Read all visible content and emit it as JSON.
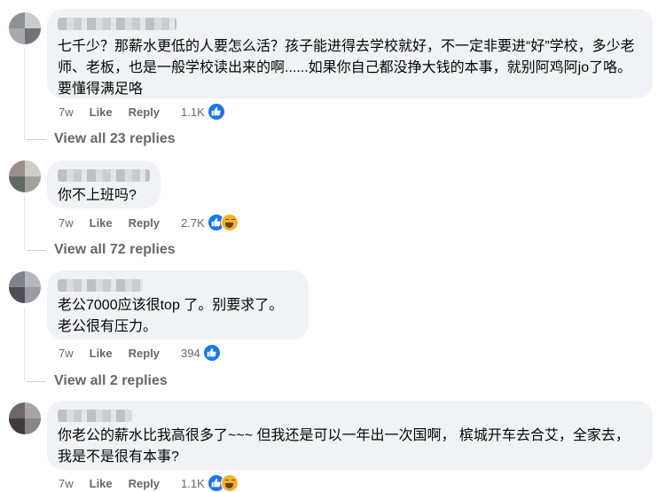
{
  "comments": [
    {
      "text": "七千少？那薪水更低的人要怎么活？孩子能进得去学校就好，不一定非要进“好”学校，多少老师、老板，也是一般学校读出来的啊......如果你自己都没挣大钱的本事，就别阿鸡阿jo了咯。要懂得满足咯",
      "time": "7w",
      "like_label": "Like",
      "reply_label": "Reply",
      "reaction_count": "1.1K",
      "reactions": [
        "like-icon"
      ],
      "replies_label": "View all 23 replies"
    },
    {
      "text": "你不上班吗?",
      "time": "7w",
      "like_label": "Like",
      "reply_label": "Reply",
      "reaction_count": "2.7K",
      "reactions": [
        "like-icon",
        "haha-icon"
      ],
      "replies_label": "View all 72 replies"
    },
    {
      "text": "老公7000应该很top 了。别要求了。\n老公很有压力。",
      "time": "7w",
      "like_label": "Like",
      "reply_label": "Reply",
      "reaction_count": "394",
      "reactions": [
        "like-icon"
      ],
      "replies_label": "View all 2 replies"
    },
    {
      "text": "你老公的薪水比我高很多了~~~ 但我还是可以一年出一次国啊， 槟城开车去合艾，全家去，我是不是很有本事?",
      "time": "7w",
      "like_label": "Like",
      "reply_label": "Reply",
      "reaction_count": "1.1K",
      "reactions": [
        "like-icon",
        "haha-icon"
      ]
    }
  ],
  "colors": {
    "bubble": "#f0f2f5",
    "meta_text": "#65676b",
    "like_blue": "#1877f2",
    "haha_yellow": "#f7b125"
  }
}
